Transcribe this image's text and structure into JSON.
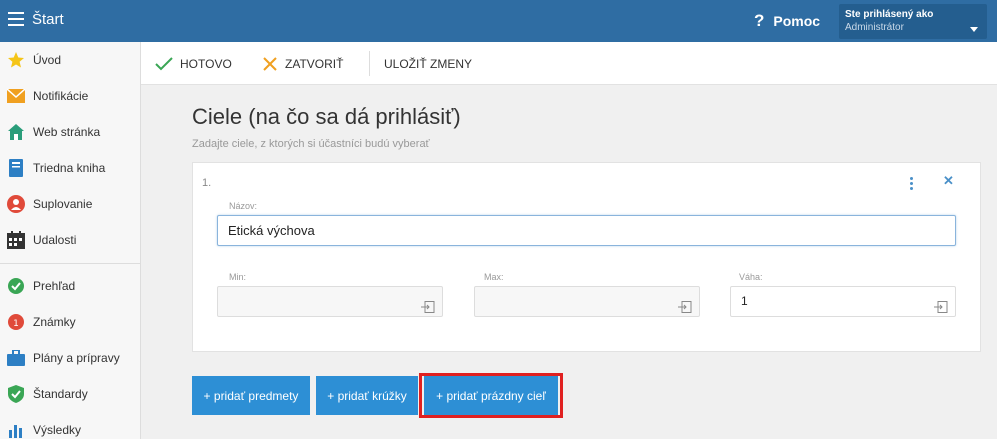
{
  "topbar": {
    "title": "Štart",
    "help_label": "Pomoc",
    "help_icon": "question-icon",
    "user_label": "Ste prihlásený ako",
    "user_role": "Administrátor"
  },
  "sidebar": {
    "items": [
      {
        "label": "Úvod",
        "icon": "star-icon"
      },
      {
        "label": "Notifikácie",
        "icon": "envelope-icon"
      },
      {
        "label": "Web stránka",
        "icon": "home-icon"
      },
      {
        "label": "Triedna kniha",
        "icon": "book-icon"
      },
      {
        "label": "Suplovanie",
        "icon": "person-icon"
      },
      {
        "label": "Udalosti",
        "icon": "calendar-icon"
      },
      {
        "label": "Prehľad",
        "icon": "check-circle-icon"
      },
      {
        "label": "Známky",
        "icon": "grade-icon"
      },
      {
        "label": "Plány a prípravy",
        "icon": "briefcase-icon"
      },
      {
        "label": "Štandardy",
        "icon": "shield-icon"
      },
      {
        "label": "Výsledky",
        "icon": "bar-chart-icon"
      }
    ]
  },
  "toolbar": {
    "done_label": "HOTOVO",
    "close_label": "ZATVORIŤ",
    "save_label": "ULOŽIŤ ZMENY"
  },
  "main": {
    "title": "Ciele (na čo sa dá prihlásiť)",
    "subtitle": "Zadajte ciele, z ktorých si účastníci budú vyberať",
    "goal": {
      "number": "1.",
      "name_label": "Názov:",
      "name_value": "Etická výchova",
      "min_label": "Min:",
      "min_value": "",
      "max_label": "Max:",
      "max_value": "",
      "weight_label": "Váha:",
      "weight_value": "1"
    },
    "buttons": {
      "add_subjects": "+ pridať predmety",
      "add_clubs": "+ pridať krúžky",
      "add_empty": "+ pridať prázdny cieľ"
    }
  },
  "colors": {
    "topbar": "#2f6da3",
    "primary_button": "#2d8fd5",
    "highlight": "#e02020",
    "done_check": "#3aa655",
    "close_x": "#f0a020"
  }
}
